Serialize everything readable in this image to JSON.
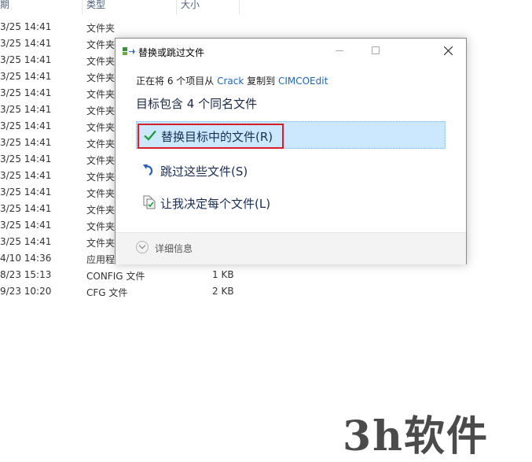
{
  "background_list": {
    "headers": {
      "date": "期",
      "type": "类型",
      "size": "大小"
    },
    "rows": [
      {
        "date": "3/25 14:41",
        "type": "文件夹",
        "size": ""
      },
      {
        "date": "3/25 14:41",
        "type": "文件夹",
        "size": ""
      },
      {
        "date": "3/25 14:41",
        "type": "文件夹",
        "size": ""
      },
      {
        "date": "3/25 14:41",
        "type": "文件夹",
        "size": ""
      },
      {
        "date": "3/25 14:41",
        "type": "文件夹",
        "size": ""
      },
      {
        "date": "3/25 14:41",
        "type": "文件夹",
        "size": ""
      },
      {
        "date": "3/25 14:41",
        "type": "文件夹",
        "size": ""
      },
      {
        "date": "3/25 14:41",
        "type": "文件夹",
        "size": ""
      },
      {
        "date": "3/25 14:41",
        "type": "文件夹",
        "size": ""
      },
      {
        "date": "3/25 14:41",
        "type": "文件夹",
        "size": ""
      },
      {
        "date": "3/25 14:41",
        "type": "文件夹",
        "size": ""
      },
      {
        "date": "3/25 14:41",
        "type": "文件夹",
        "size": ""
      },
      {
        "date": "3/25 14:41",
        "type": "文件夹",
        "size": ""
      },
      {
        "date": "3/25 14:41",
        "type": "文件夹",
        "size": ""
      },
      {
        "date": "4/10 14:36",
        "type": "应用程序",
        "size": ""
      },
      {
        "date": "8/23 15:13",
        "type": "CONFIG 文件",
        "size": "1 KB"
      },
      {
        "date": "9/23 10:20",
        "type": "CFG 文件",
        "size": "2 KB"
      }
    ]
  },
  "dialog": {
    "title": "替换或跳过文件",
    "copy_prefix": "正在将 6 个项目从 ",
    "source": "Crack",
    "copy_middle": " 复制到 ",
    "destination": "CIMCOEdit",
    "headline": "目标包含 4 个同名文件",
    "options": [
      {
        "label": "替换目标中的文件(R)",
        "icon": "checkmark-icon"
      },
      {
        "label": "跳过这些文件(S)",
        "icon": "skip-arrow-icon"
      },
      {
        "label": "让我决定每个文件(L)",
        "icon": "compare-files-icon"
      }
    ],
    "details_label": "详细信息"
  },
  "colors": {
    "accent": "#1a66b8",
    "selected_bg": "#cce8ff",
    "highlight_border": "#d9202a",
    "check_green": "#1f9d3a"
  },
  "watermark": "3h软件"
}
